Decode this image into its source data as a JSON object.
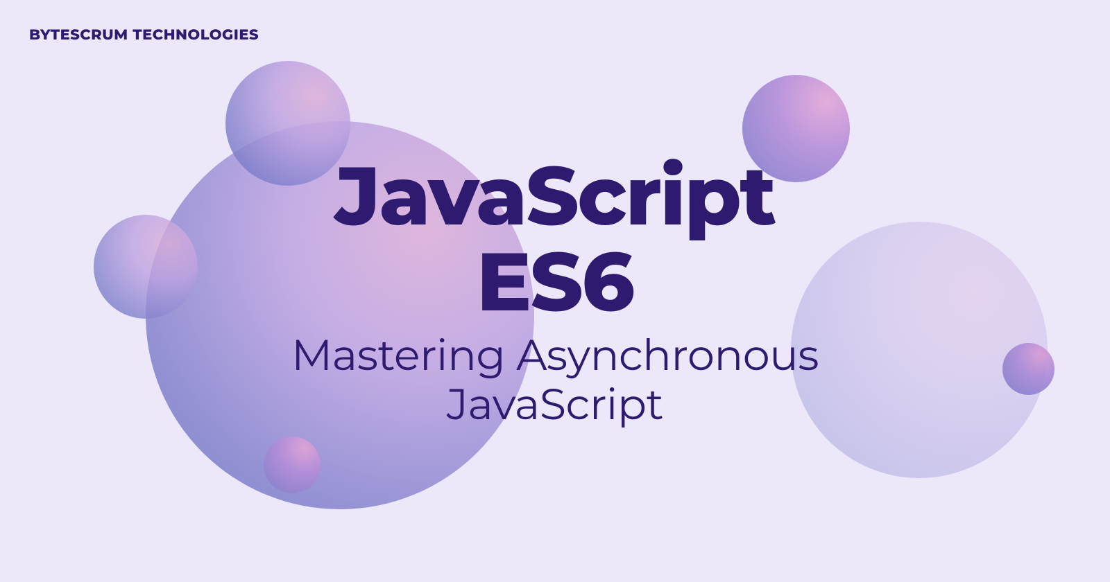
{
  "brand": "BYTESCRUM TECHNOLOGIES",
  "title": "JavaScript ES6",
  "subtitle": "Mastering Asynchronous JavaScript",
  "colors": {
    "background": "#ece7f9",
    "text": "#2e1a6e",
    "gradient_light": "#dcaed8",
    "gradient_mid": "#bda3e1",
    "gradient_dark": "#6874c2"
  }
}
